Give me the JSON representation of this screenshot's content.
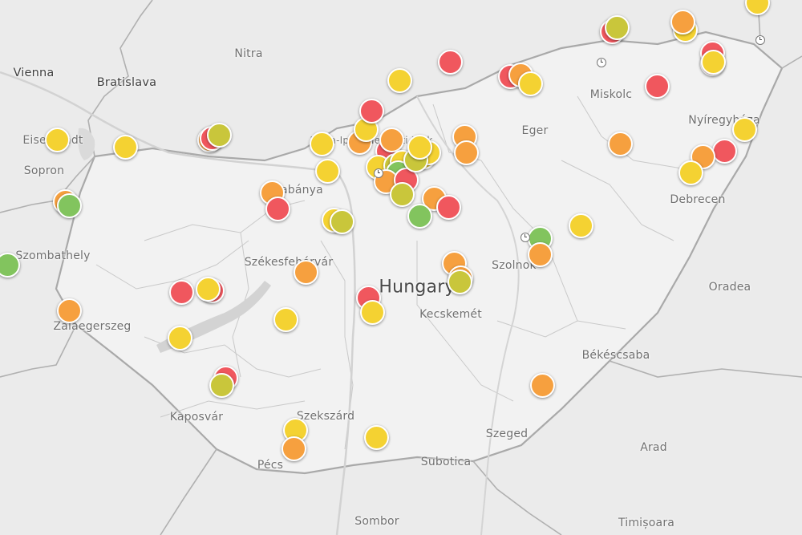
{
  "map": {
    "labels": [
      {
        "id": "vienna",
        "text": "Vienna",
        "cls": "major"
      },
      {
        "id": "bratislava",
        "text": "Bratislava",
        "cls": "major"
      },
      {
        "id": "nitra",
        "text": "Nitra",
        "cls": ""
      },
      {
        "id": "eisenstadt",
        "text": "Eisenstadt",
        "cls": ""
      },
      {
        "id": "sopron",
        "text": "Sopron",
        "cls": ""
      },
      {
        "id": "tatabanya",
        "text": "Tatabánya",
        "cls": ""
      },
      {
        "id": "park",
        "text": "Duna-Ipoly Nemzeti Park",
        "cls": "small"
      },
      {
        "id": "eger",
        "text": "Eger",
        "cls": ""
      },
      {
        "id": "miskolc",
        "text": "Miskolc",
        "cls": ""
      },
      {
        "id": "nyiregyhaza",
        "text": "Nyíregyháza",
        "cls": ""
      },
      {
        "id": "debrecen",
        "text": "Debrecen",
        "cls": ""
      },
      {
        "id": "szombathely",
        "text": "Szombathely",
        "cls": ""
      },
      {
        "id": "szekesfehervar",
        "text": "Székesfehérvár",
        "cls": ""
      },
      {
        "id": "hungary",
        "text": "Hungary",
        "cls": "country"
      },
      {
        "id": "szolnok",
        "text": "Szolnok",
        "cls": ""
      },
      {
        "id": "oradea",
        "text": "Oradea",
        "cls": ""
      },
      {
        "id": "zalaegerszeg",
        "text": "Zalaegerszeg",
        "cls": ""
      },
      {
        "id": "kecskemet",
        "text": "Kecskemét",
        "cls": ""
      },
      {
        "id": "bekescsaba",
        "text": "Békéscsaba",
        "cls": ""
      },
      {
        "id": "kaposvar",
        "text": "Kaposvár",
        "cls": ""
      },
      {
        "id": "szekszard",
        "text": "Szekszárd",
        "cls": ""
      },
      {
        "id": "szeged",
        "text": "Szeged",
        "cls": ""
      },
      {
        "id": "arad",
        "text": "Arad",
        "cls": ""
      },
      {
        "id": "pecs",
        "text": "Pécs",
        "cls": ""
      },
      {
        "id": "subotica",
        "text": "Subotica",
        "cls": ""
      },
      {
        "id": "sombor",
        "text": "Sombor",
        "cls": ""
      },
      {
        "id": "timisoara",
        "text": "Timișoara",
        "cls": ""
      }
    ],
    "colors": {
      "red": "#f0575e",
      "orange": "#f6a03f",
      "yellow": "#f4d232",
      "lime": "#c9c63b",
      "green": "#82c45e"
    },
    "markers": [
      {
        "lat": 47.78,
        "lon": 16.62,
        "color": "yellow"
      },
      {
        "lat": 47.74,
        "lon": 17.13,
        "color": "yellow"
      },
      {
        "lat": 47.44,
        "lon": 16.68,
        "color": "orange"
      },
      {
        "lat": 47.42,
        "lon": 16.71,
        "color": "green"
      },
      {
        "lat": 47.09,
        "lon": 16.25,
        "color": "green"
      },
      {
        "lat": 46.84,
        "lon": 16.71,
        "color": "orange"
      },
      {
        "lat": 46.94,
        "lon": 17.55,
        "color": "red"
      },
      {
        "lat": 46.95,
        "lon": 17.78,
        "color": "red"
      },
      {
        "lat": 46.96,
        "lon": 17.75,
        "color": "yellow"
      },
      {
        "lat": 46.69,
        "lon": 17.54,
        "color": "yellow"
      },
      {
        "lat": 47.78,
        "lon": 17.76,
        "color": "orange"
      },
      {
        "lat": 47.79,
        "lon": 17.78,
        "color": "red"
      },
      {
        "lat": 47.81,
        "lon": 17.83,
        "color": "lime"
      },
      {
        "lat": 47.49,
        "lon": 18.23,
        "color": "orange"
      },
      {
        "lat": 47.4,
        "lon": 18.27,
        "color": "red"
      },
      {
        "lat": 47.05,
        "lon": 18.48,
        "color": "orange"
      },
      {
        "lat": 47.34,
        "lon": 18.69,
        "color": "yellow"
      },
      {
        "lat": 47.33,
        "lon": 18.75,
        "color": "lime"
      },
      {
        "lat": 47.76,
        "lon": 18.6,
        "color": "yellow"
      },
      {
        "lat": 47.61,
        "lon": 18.64,
        "color": "yellow"
      },
      {
        "lat": 47.77,
        "lon": 18.88,
        "color": "orange"
      },
      {
        "lat": 47.84,
        "lon": 18.93,
        "color": "yellow"
      },
      {
        "lat": 47.94,
        "lon": 18.97,
        "color": "red"
      },
      {
        "lat": 48.11,
        "lon": 19.18,
        "color": "yellow"
      },
      {
        "lat": 47.72,
        "lon": 19.09,
        "color": "red"
      },
      {
        "lat": 47.78,
        "lon": 19.12,
        "color": "orange"
      },
      {
        "lat": 47.61,
        "lon": 19.07,
        "color": "orange"
      },
      {
        "lat": 47.63,
        "lon": 19.02,
        "color": "yellow"
      },
      {
        "lat": 47.64,
        "lon": 19.15,
        "color": "lime"
      },
      {
        "lat": 47.66,
        "lon": 19.2,
        "color": "yellow"
      },
      {
        "lat": 47.6,
        "lon": 19.17,
        "color": "green"
      },
      {
        "lat": 47.55,
        "lon": 19.08,
        "color": "orange"
      },
      {
        "lat": 47.56,
        "lon": 19.23,
        "color": "red"
      },
      {
        "lat": 47.48,
        "lon": 19.2,
        "color": "lime"
      },
      {
        "lat": 47.69,
        "lon": 19.36,
        "color": "yellow"
      },
      {
        "lat": 47.71,
        "lon": 19.4,
        "color": "yellow"
      },
      {
        "lat": 47.67,
        "lon": 19.3,
        "color": "lime"
      },
      {
        "lat": 47.74,
        "lon": 19.33,
        "color": "yellow"
      },
      {
        "lat": 47.46,
        "lon": 19.44,
        "color": "orange"
      },
      {
        "lat": 47.36,
        "lon": 19.33,
        "color": "green"
      },
      {
        "lat": 47.41,
        "lon": 19.55,
        "color": "red"
      },
      {
        "lat": 47.8,
        "lon": 19.67,
        "color": "orange"
      },
      {
        "lat": 47.71,
        "lon": 19.68,
        "color": "orange"
      },
      {
        "lat": 48.21,
        "lon": 19.56,
        "color": "red"
      },
      {
        "lat": 48.13,
        "lon": 20.01,
        "color": "red"
      },
      {
        "lat": 48.14,
        "lon": 20.09,
        "color": "orange"
      },
      {
        "lat": 48.09,
        "lon": 20.16,
        "color": "yellow"
      },
      {
        "lat": 47.1,
        "lon": 19.59,
        "color": "orange"
      },
      {
        "lat": 47.02,
        "lon": 19.64,
        "color": "orange"
      },
      {
        "lat": 47.0,
        "lon": 19.63,
        "color": "lime"
      },
      {
        "lat": 46.91,
        "lon": 18.95,
        "color": "red"
      },
      {
        "lat": 46.83,
        "lon": 18.98,
        "color": "yellow"
      },
      {
        "lat": 46.79,
        "lon": 18.33,
        "color": "yellow"
      },
      {
        "lat": 46.47,
        "lon": 17.88,
        "color": "red"
      },
      {
        "lat": 46.43,
        "lon": 17.85,
        "color": "lime"
      },
      {
        "lat": 46.18,
        "lon": 18.4,
        "color": "yellow"
      },
      {
        "lat": 46.08,
        "lon": 18.39,
        "color": "orange"
      },
      {
        "lat": 46.14,
        "lon": 19.01,
        "color": "yellow"
      },
      {
        "lat": 46.43,
        "lon": 20.25,
        "color": "orange"
      },
      {
        "lat": 47.24,
        "lon": 20.23,
        "color": "green"
      },
      {
        "lat": 47.15,
        "lon": 20.23,
        "color": "orange"
      },
      {
        "lat": 47.31,
        "lon": 20.54,
        "color": "yellow"
      },
      {
        "lat": 48.38,
        "lon": 20.77,
        "color": "red"
      },
      {
        "lat": 48.4,
        "lon": 20.81,
        "color": "lime"
      },
      {
        "lat": 48.39,
        "lon": 21.32,
        "color": "yellow"
      },
      {
        "lat": 48.43,
        "lon": 21.3,
        "color": "orange"
      },
      {
        "lat": 48.54,
        "lon": 21.86,
        "color": "yellow"
      },
      {
        "lat": 48.66,
        "lon": 21.47,
        "color": "orange"
      },
      {
        "lat": 48.26,
        "lon": 21.52,
        "color": "red"
      },
      {
        "lat": 48.2,
        "lon": 21.52,
        "color": "red"
      },
      {
        "lat": 48.21,
        "lon": 21.53,
        "color": "yellow"
      },
      {
        "lat": 48.08,
        "lon": 21.11,
        "color": "red"
      },
      {
        "lat": 47.76,
        "lon": 20.83,
        "color": "orange"
      },
      {
        "lat": 47.84,
        "lon": 21.76,
        "color": "yellow"
      },
      {
        "lat": 47.72,
        "lon": 21.61,
        "color": "red"
      },
      {
        "lat": 47.69,
        "lon": 21.45,
        "color": "orange"
      },
      {
        "lat": 47.6,
        "lon": 21.36,
        "color": "yellow"
      }
    ]
  }
}
